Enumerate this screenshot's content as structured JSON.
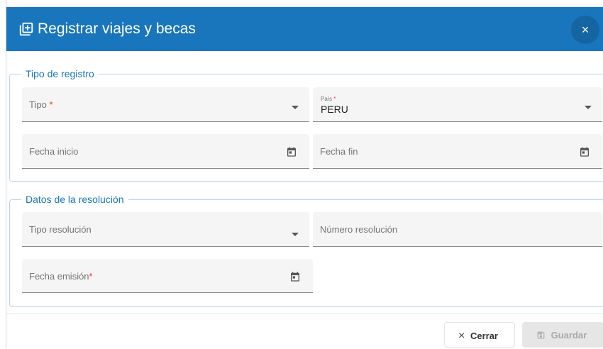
{
  "dialog": {
    "title": "Registrar viajes y becas",
    "close_icon": "×"
  },
  "section_tipo": {
    "legend": "Tipo de registro",
    "tipo": {
      "label": "Tipo",
      "required": "*",
      "value": ""
    },
    "pais": {
      "label": "País",
      "required": "*",
      "value": "PERU"
    },
    "fecha_inicio": {
      "label": "Fecha inicio"
    },
    "fecha_fin": {
      "label": "Fecha fin"
    }
  },
  "section_resolucion": {
    "legend": "Datos de la resolución",
    "tipo_resolucion": {
      "label": "Tipo resolución"
    },
    "numero_resolucion": {
      "label": "Número resolución"
    },
    "fecha_emision": {
      "label": "Fecha emisión",
      "required": "*"
    }
  },
  "footer": {
    "close_label": "Cerrar",
    "close_icon": "×",
    "save_label": "Guardar"
  },
  "icons": {
    "title": "add-box-icon",
    "dropdown": "dropdown-arrow-icon",
    "date": "calendar-icon",
    "save": "save-icon"
  },
  "colors": {
    "header": "#1976bc",
    "legend": "#1976bc",
    "required": "#e53935"
  }
}
